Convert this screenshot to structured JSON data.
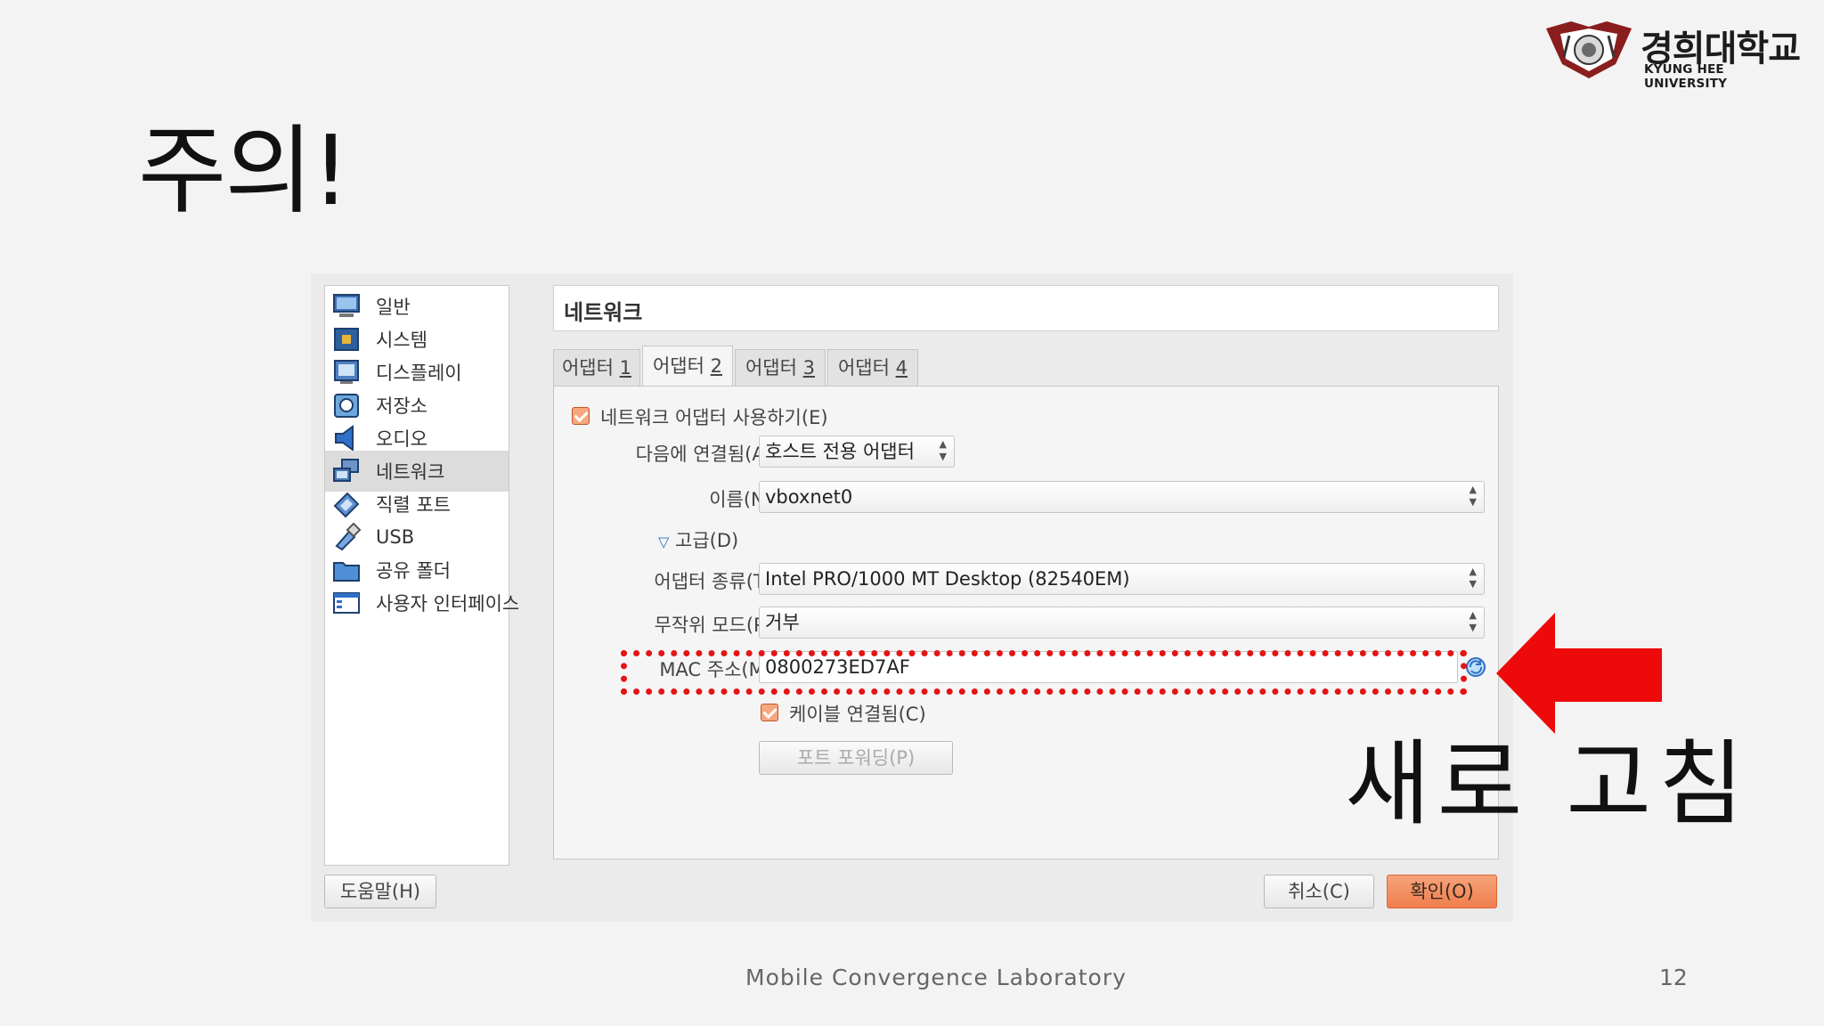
{
  "slide": {
    "title": "주의!",
    "overlay_text": "새로 고침",
    "footer": "Mobile Convergence Laboratory",
    "page_number": "12"
  },
  "logo": {
    "korean_name": "경희대학교",
    "english_name": "KYUNG HEE UNIVERSITY"
  },
  "sidebar": {
    "items": [
      {
        "label": "일반",
        "icon": "monitor-icon"
      },
      {
        "label": "시스템",
        "icon": "chip-icon"
      },
      {
        "label": "디스플레이",
        "icon": "display-icon"
      },
      {
        "label": "저장소",
        "icon": "disk-icon"
      },
      {
        "label": "오디오",
        "icon": "speaker-icon"
      },
      {
        "label": "네트워크",
        "icon": "network-icon"
      },
      {
        "label": "직렬 포트",
        "icon": "serial-port-icon"
      },
      {
        "label": "USB",
        "icon": "usb-icon"
      },
      {
        "label": "공유 폴더",
        "icon": "folder-icon"
      },
      {
        "label": "사용자 인터페이스",
        "icon": "window-icon"
      }
    ],
    "selected": "네트워크"
  },
  "header": {
    "title": "네트워크"
  },
  "tabs": [
    {
      "label": "어댑터 ",
      "key": "1"
    },
    {
      "label": "어댑터 ",
      "key": "2"
    },
    {
      "label": "어댑터 ",
      "key": "3"
    },
    {
      "label": "어댑터 ",
      "key": "4"
    }
  ],
  "active_tab": "어댑터 2",
  "adapter": {
    "enable_label": "네트워크 어댑터 사용하기(E)",
    "enable_checked": true,
    "attached_label": "다음에 연결됨(A):",
    "attached_value": "호스트 전용 어댑터",
    "name_label": "이름(N):",
    "name_value": "vboxnet0",
    "advanced_label": "고급(D)",
    "type_label": "어댑터 종류(T):",
    "type_value": "Intel PRO/1000 MT Desktop (82540EM)",
    "promisc_label": "무작위 모드(P):",
    "promisc_value": "거부",
    "mac_label": "MAC 주소(M):",
    "mac_value": "0800273ED7AF",
    "cable_label": "케이블 연결됨(C)",
    "cable_checked": true,
    "port_forward_label": "포트 포워딩(P)"
  },
  "buttons": {
    "help": "도움말(H)",
    "cancel": "취소(C)",
    "ok": "확인(O)"
  },
  "colors": {
    "accent": "#ef7f4e",
    "highlight": "#e41414",
    "arrow": "#ee0a0a"
  }
}
